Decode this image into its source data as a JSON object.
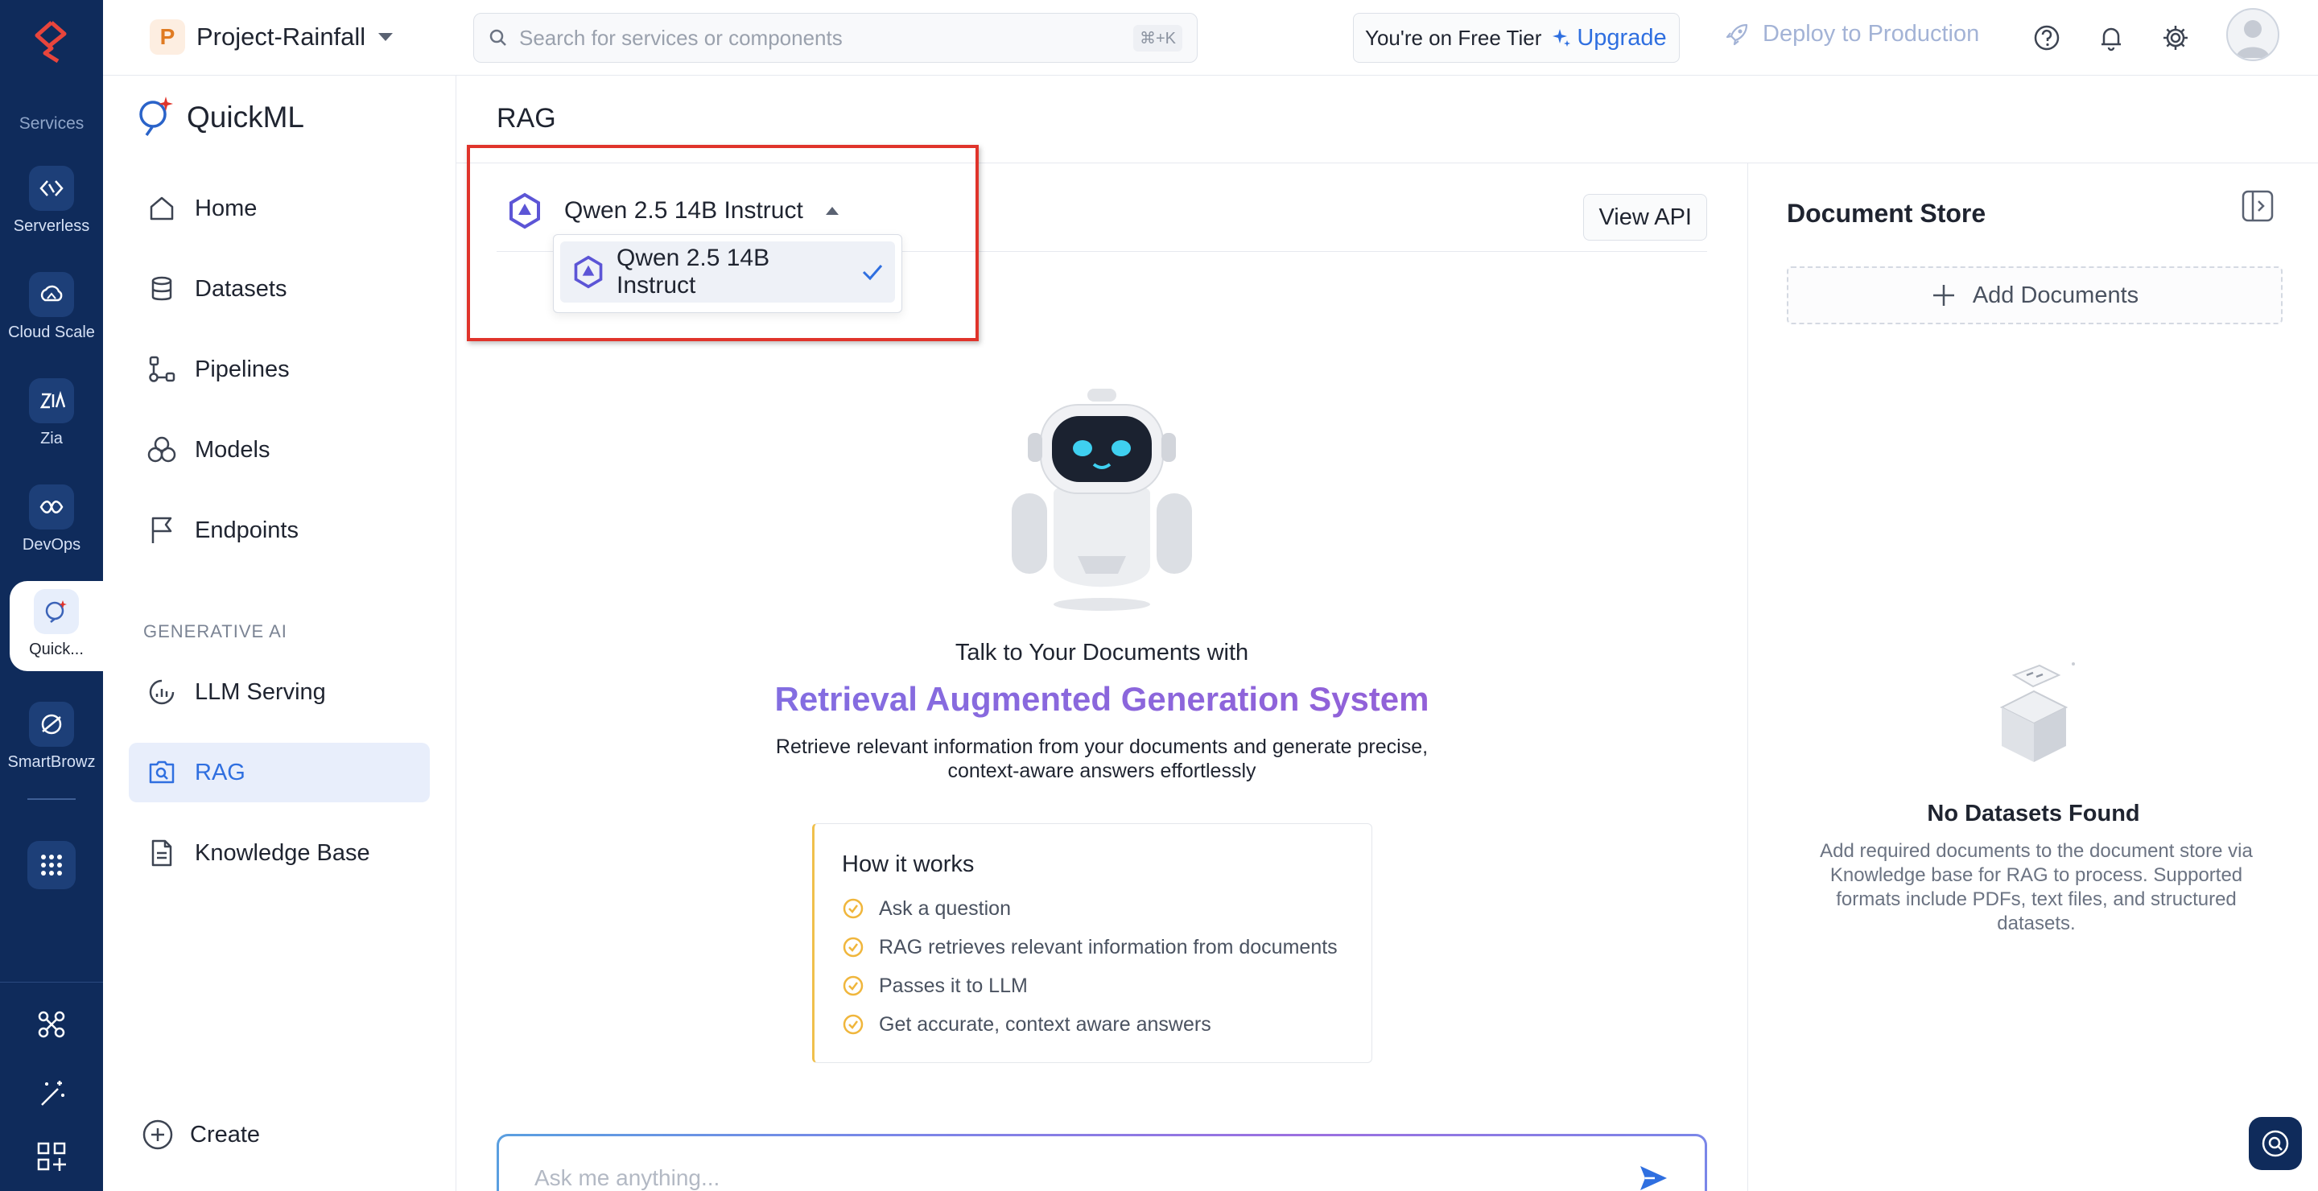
{
  "rail": {
    "section_label": "Services",
    "items": [
      {
        "label": "Serverless",
        "icon": "serverless-icon"
      },
      {
        "label": "Cloud Scale",
        "icon": "cloud-scale-icon"
      },
      {
        "label": "Zia",
        "icon": "zia-icon"
      },
      {
        "label": "DevOps",
        "icon": "devops-icon"
      },
      {
        "label": "Quick...",
        "icon": "quickml-icon",
        "active": true
      },
      {
        "label": "SmartBrowz",
        "icon": "smartbrowz-icon"
      }
    ]
  },
  "topbar": {
    "project_initial": "P",
    "project_name": "Project-Rainfall",
    "search_placeholder": "Search for services or components",
    "search_shortcut": "⌘+K",
    "tier_text": "You're on Free Tier",
    "upgrade_label": "Upgrade",
    "deploy_label": "Deploy to Production"
  },
  "sidebar": {
    "brand": "QuickML",
    "items": [
      {
        "label": "Home",
        "icon": "home-icon"
      },
      {
        "label": "Datasets",
        "icon": "database-icon"
      },
      {
        "label": "Pipelines",
        "icon": "pipeline-icon"
      },
      {
        "label": "Models",
        "icon": "models-icon"
      },
      {
        "label": "Endpoints",
        "icon": "flag-icon"
      }
    ],
    "section_label": "GENERATIVE AI",
    "gen_items": [
      {
        "label": "LLM Serving",
        "icon": "llm-serving-icon"
      },
      {
        "label": "RAG",
        "icon": "rag-icon",
        "active": true
      },
      {
        "label": "Knowledge Base",
        "icon": "document-icon"
      }
    ],
    "create_label": "Create"
  },
  "main": {
    "title": "RAG",
    "model_selected": "Qwen 2.5 14B Instruct",
    "dropdown_options": [
      "Qwen 2.5 14B Instruct"
    ],
    "view_api_label": "View API",
    "talk_line1": "Talk to Your Documents with",
    "talk_line2": "Retrieval Augmented Generation System",
    "talk_line3a": "Retrieve relevant information from your documents and generate precise,",
    "talk_line3b": "context-aware answers effortlessly",
    "how_title": "How it works",
    "how_steps": [
      "Ask a question",
      "RAG retrieves relevant information from documents",
      "Passes it to LLM",
      "Get accurate, context aware answers"
    ],
    "ask_placeholder": "Ask me anything..."
  },
  "docs": {
    "title": "Document Store",
    "add_label": "Add Documents",
    "empty_title": "No Datasets Found",
    "empty_desc": "Add required documents to the document store via Knowledge base for RAG to process. Supported formats include PDFs, text files, and structured datasets."
  },
  "colors": {
    "rail_bg": "#0f2b5b",
    "accent": "#2f6fe0",
    "highlight": "#e0342b",
    "gradient_start": "#7b74e6",
    "gradient_end": "#9a5ad3"
  }
}
